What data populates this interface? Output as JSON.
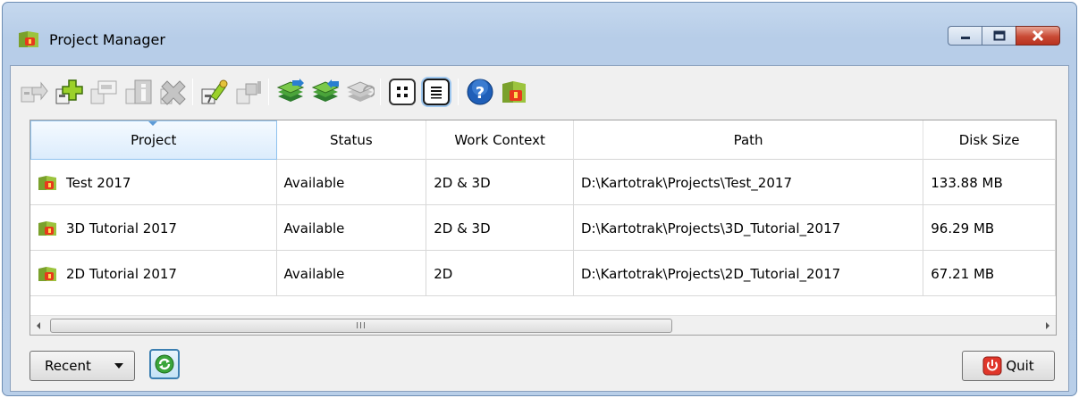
{
  "window": {
    "title": "Project Manager",
    "icon": "project-manager-icon",
    "controls": [
      "minimize-icon",
      "maximize-icon",
      "close-icon"
    ]
  },
  "toolbar": {
    "buttons": [
      {
        "name": "open-project",
        "icon": "open-project-icon",
        "enabled": false
      },
      {
        "name": "new-project",
        "icon": "new-project-plus-icon",
        "enabled": true
      },
      {
        "name": "rename-project",
        "icon": "rename-project-icon",
        "enabled": false
      },
      {
        "name": "project-info",
        "icon": "info-icon",
        "enabled": false
      },
      {
        "name": "delete-project",
        "icon": "delete-x-icon",
        "enabled": false
      },
      {
        "name": "attach-project",
        "icon": "pin-icon",
        "enabled": true
      },
      {
        "name": "detach-project",
        "icon": "detach-icon",
        "enabled": false
      },
      {
        "name": "import-project",
        "icon": "import-layers-icon",
        "enabled": true
      },
      {
        "name": "export-project",
        "icon": "export-layers-icon",
        "enabled": true
      },
      {
        "name": "copy-project",
        "icon": "copy-layers-icon",
        "enabled": false
      },
      {
        "name": "icon-view",
        "icon": "grid-view-icon",
        "enabled": true
      },
      {
        "name": "details-view",
        "icon": "list-view-icon",
        "enabled": true
      },
      {
        "name": "help",
        "icon": "help-question-icon",
        "enabled": true
      },
      {
        "name": "about",
        "icon": "kartotrak-logo-icon",
        "enabled": true
      }
    ]
  },
  "grid": {
    "columns": [
      "Project",
      "Status",
      "Work Context",
      "Path",
      "Disk Size"
    ],
    "sorted_column": "Project",
    "rows": [
      {
        "project": "Test 2017",
        "status": "Available",
        "context": "2D & 3D",
        "path": "D:\\Kartotrak\\Projects\\Test_2017",
        "size": "133.88 MB"
      },
      {
        "project": "3D Tutorial 2017",
        "status": "Available",
        "context": "2D & 3D",
        "path": "D:\\Kartotrak\\Projects\\3D_Tutorial_2017",
        "size": "96.29 MB"
      },
      {
        "project": "2D Tutorial 2017",
        "status": "Available",
        "context": "2D",
        "path": "D:\\Kartotrak\\Projects\\2D_Tutorial_2017",
        "size": "67.21 MB"
      }
    ],
    "scroll_grip": "III"
  },
  "footer": {
    "recent_label": "Recent",
    "quit_label": "Quit"
  },
  "colors": {
    "frame": "#b9cfe9",
    "client": "#f0f0f0",
    "close_button": "#c94a35",
    "accent_blue": "#3c7fb1"
  }
}
